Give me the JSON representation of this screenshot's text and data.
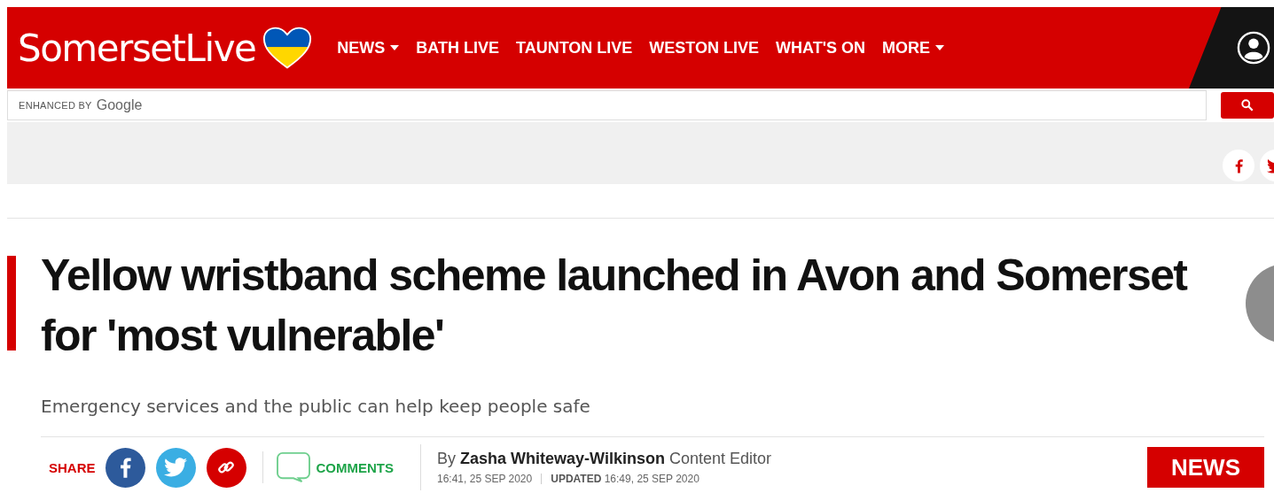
{
  "header": {
    "logo": "SomersetLive",
    "nav": [
      {
        "label": "NEWS",
        "dropdown": true
      },
      {
        "label": "BATH LIVE",
        "dropdown": false
      },
      {
        "label": "TAUNTON LIVE",
        "dropdown": false
      },
      {
        "label": "WESTON LIVE",
        "dropdown": false
      },
      {
        "label": "WHAT'S ON",
        "dropdown": false
      },
      {
        "label": "MORE",
        "dropdown": true
      }
    ]
  },
  "search": {
    "prefix": "ENHANCED BY",
    "brand": "Google"
  },
  "article": {
    "headline": "Yellow wristband scheme launched in Avon and Somerset for 'most vulnerable'",
    "standfirst": "Emergency services and the public can help keep people safe",
    "share_label": "SHARE",
    "comments_label": "COMMENTS",
    "byline_prefix": "By",
    "author": "Zasha Whiteway-Wilkinson",
    "role": "Content Editor",
    "published": "16:41, 25 SEP 2020",
    "updated_label": "UPDATED",
    "updated": "16:49, 25 SEP 2020",
    "section": "NEWS"
  }
}
